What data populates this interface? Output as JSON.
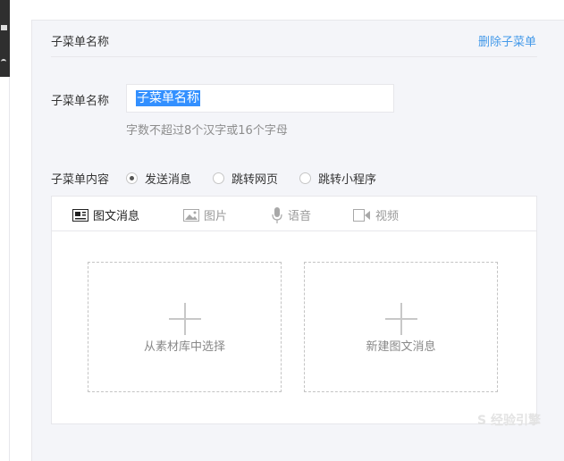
{
  "submenu": {
    "header_title": "子菜单名称",
    "delete_label": "删除子菜单",
    "name_label": "子菜单名称",
    "name_value": "子菜单名称",
    "hint": "字数不超过8个汉字或16个字母",
    "content_label": "子菜单内容",
    "options": [
      "发送消息",
      "跳转网页",
      "跳转小程序"
    ],
    "selected_option": "发送消息"
  },
  "tabs": [
    "图文消息",
    "图片",
    "语音",
    "视频"
  ],
  "active_tab": "图文消息",
  "cards": {
    "library_label": "从素材库中选择",
    "new_label": "新建图文消息"
  },
  "watermark": "S 经验引擎"
}
